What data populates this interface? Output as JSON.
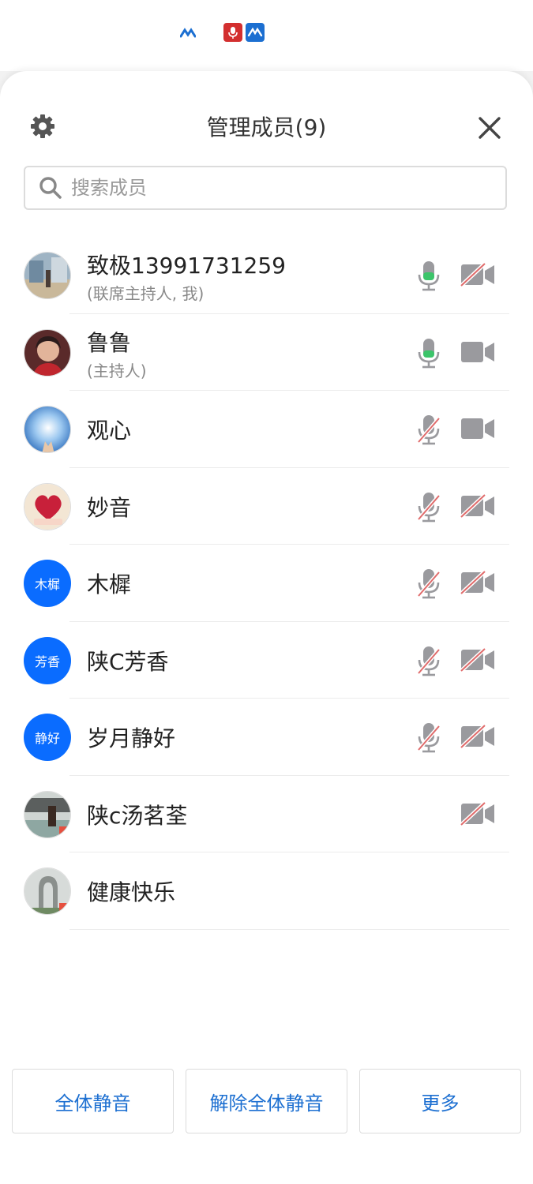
{
  "header": {
    "title": "管理成员(9)"
  },
  "search": {
    "placeholder": "搜索成员"
  },
  "members": [
    {
      "name": "致极13991731259",
      "role": "(联席主持人, 我)",
      "mic": "on",
      "cam": "off"
    },
    {
      "name": "鲁鲁",
      "role": "(主持人)",
      "mic": "on",
      "cam": "on"
    },
    {
      "name": "观心",
      "mic": "muted",
      "cam": "on"
    },
    {
      "name": "妙音",
      "mic": "muted",
      "cam": "off"
    },
    {
      "name": "木樨",
      "avatar_text": "木樨",
      "mic": "muted",
      "cam": "off"
    },
    {
      "name": "陕C芳香",
      "avatar_text": "芳香",
      "mic": "muted",
      "cam": "off"
    },
    {
      "name": "岁月静好",
      "avatar_text": "静好",
      "mic": "muted",
      "cam": "off"
    },
    {
      "name": "陕c汤茗荃",
      "mic": "none",
      "cam": "off"
    },
    {
      "name": "健康快乐",
      "mic": "none",
      "cam": "none"
    }
  ],
  "footer": {
    "mute_all": "全体静音",
    "unmute_all": "解除全体静音",
    "more": "更多"
  },
  "colors": {
    "accent": "#1c6fd1",
    "avatar_bg": "#0a6cff",
    "mic_active": "#3cc46a",
    "muted_slash": "#e06b6b",
    "icon_gray": "#8e8e93"
  }
}
